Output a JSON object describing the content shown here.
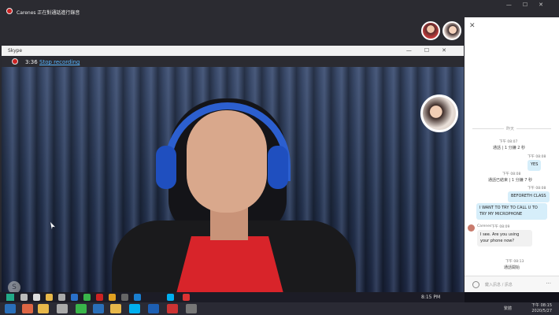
{
  "top_bar": {
    "recording_notice": "Carenes 正在對通話進行錄音",
    "window_controls": [
      "—",
      "☐",
      "✕"
    ]
  },
  "window": {
    "title": "Skype",
    "controls": [
      "—",
      "☐",
      "✕"
    ]
  },
  "call": {
    "elapsed": "3:36",
    "stop_recording_label": "Stop recording"
  },
  "chat": {
    "date_separator": "昨天",
    "messages": [
      {
        "time": "下午 08:07",
        "text": "通話 | 1 分鐘 2 秒",
        "side": "center"
      },
      {
        "time": "下午 08:08",
        "text": "YES",
        "side": "out"
      },
      {
        "time": "下午 08:08",
        "text": "通話已結束 | 1 分鐘 7 秒",
        "side": "center"
      },
      {
        "time": "下午 08:08",
        "text": "BEFORETH CLASS",
        "side": "out"
      },
      {
        "time": "",
        "text": "I WANT TO TRY TO CALL U TO TRY MY MICROPHONE",
        "side": "out"
      },
      {
        "sender": "Carenes",
        "time": "下午 08:09",
        "text": "I see. Are you using your phone now?",
        "side": "in"
      },
      {
        "time": "下午 08:13",
        "text": "通話開始",
        "side": "center"
      }
    ],
    "input_placeholder": "鍵入訊息 / 訊息"
  },
  "taskbar": {
    "tray_time": "8:15 PM",
    "clock_time": "下午 08:15",
    "clock_date": "2020/5/27",
    "language": "繁體"
  },
  "colors": {
    "recording_red": "#cc2222",
    "link_blue": "#58b4ff",
    "bubble_out": "#d6eefa",
    "chrome_dark": "#2b2b31"
  },
  "icons": [
    "record-icon",
    "close-icon",
    "minimize-icon",
    "maximize-icon",
    "emoji-icon",
    "more-icon",
    "windows-icon",
    "search-icon"
  ]
}
